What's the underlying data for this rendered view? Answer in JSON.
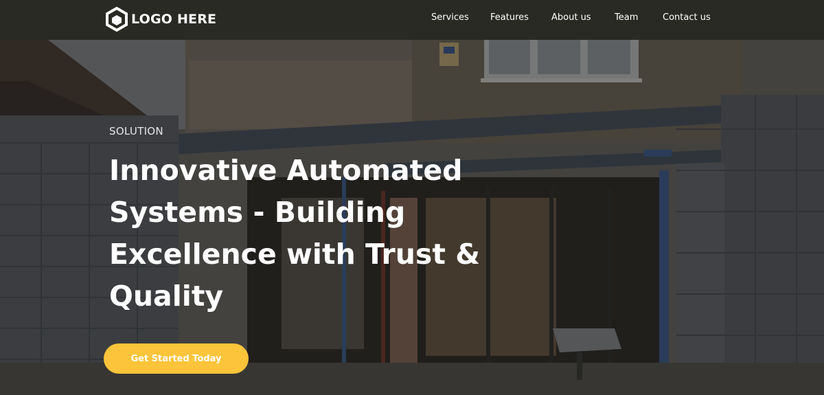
{
  "brand": {
    "logo_text": "LOGO HERE",
    "icon": "hexagon-cube-icon"
  },
  "nav": {
    "items": [
      {
        "label": "Services"
      },
      {
        "label": "Features"
      },
      {
        "label": "About us"
      },
      {
        "label": "Team"
      },
      {
        "label": "Contact us"
      }
    ]
  },
  "hero": {
    "eyebrow": "SOLUTION",
    "title": "Innovative Automated Systems - Building Excellence with Trust & Quality",
    "cta_label": "Get Started Today"
  },
  "colors": {
    "navbar": "#2a2a25",
    "accent": "#fcc43a",
    "text": "#ffffff"
  }
}
